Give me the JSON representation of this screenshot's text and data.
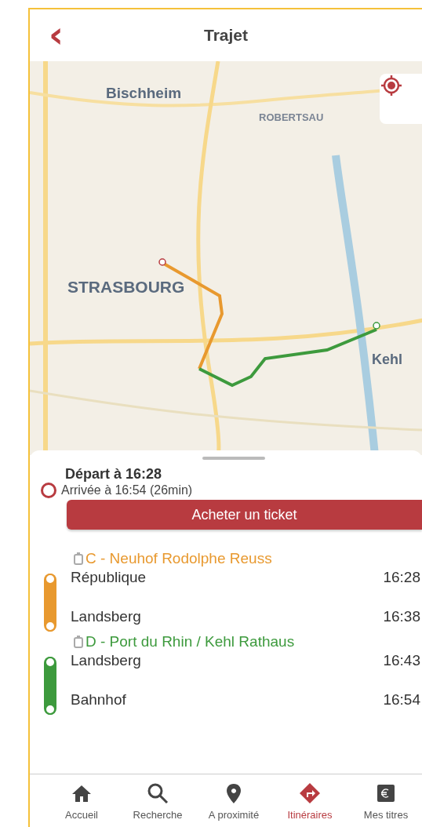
{
  "header": {
    "back": "‹",
    "title": "Trajet"
  },
  "map": {
    "labels": [
      {
        "text": "Bischheim",
        "kind": "town"
      },
      {
        "text": "ROBERTSAU",
        "kind": "district"
      },
      {
        "text": "STRASBOURG",
        "kind": "city"
      },
      {
        "text": "Kehl",
        "kind": "town"
      }
    ]
  },
  "summary": {
    "departure": "Départ à 16:28",
    "arrival": "Arrivée à 16:54 (26min)",
    "button": "Acheter un ticket"
  },
  "legs": [
    {
      "line": "C - Neuhof Rodolphe Reuss",
      "color": "#e8992f",
      "stops": [
        {
          "name": "République",
          "time": "16:28"
        },
        {
          "name": "Landsberg",
          "time": "16:38"
        }
      ]
    },
    {
      "line": "D - Port du Rhin / Kehl Rathaus",
      "color": "#3d9a3d",
      "stops": [
        {
          "name": "Landsberg",
          "time": "16:43"
        },
        {
          "name": "Bahnhof",
          "time": "16:54"
        }
      ]
    }
  ],
  "nav": [
    {
      "label": "Accueil",
      "kind": "home",
      "selected": false
    },
    {
      "label": "Recherche",
      "kind": "search",
      "selected": false
    },
    {
      "label": "A proximité",
      "kind": "pin",
      "selected": false
    },
    {
      "label": "Itinéraires",
      "kind": "route",
      "selected": true
    },
    {
      "label": "Mes titres",
      "kind": "ticket",
      "selected": false
    }
  ]
}
